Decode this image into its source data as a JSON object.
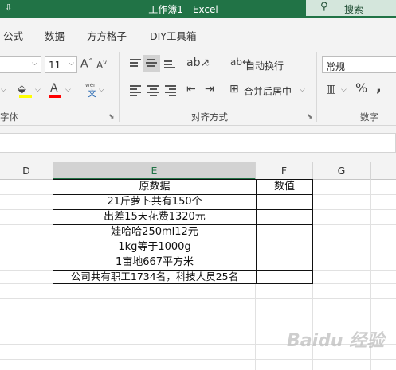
{
  "titlebar": {
    "quick_access": "⇩",
    "title": "工作簿1  -  Excel",
    "search_label": "搜索"
  },
  "tabs": [
    "公式",
    "数据",
    "方方格子",
    "DIY工具箱"
  ],
  "ribbon": {
    "font_size": "11",
    "font_group_label": "字体",
    "align_group_label": "对齐方式",
    "number_group_label": "数字",
    "wrap_text": "自动换行",
    "merge_center": "合并后居中",
    "number_format": "常规",
    "phonetic_top": "wén",
    "phonetic_bottom": "文"
  },
  "columns": [
    "D",
    "E",
    "F",
    "G"
  ],
  "table": {
    "header_source": "原数据",
    "header_value": "数值",
    "rows": [
      "21斤萝卜共有150个",
      "出差15天花费1320元",
      "娃哈哈250ml12元",
      "1kg等于1000g",
      "1亩地667平方米",
      "公司共有职工1734名，科技人员25名"
    ]
  },
  "watermark": "Baidu 经验"
}
